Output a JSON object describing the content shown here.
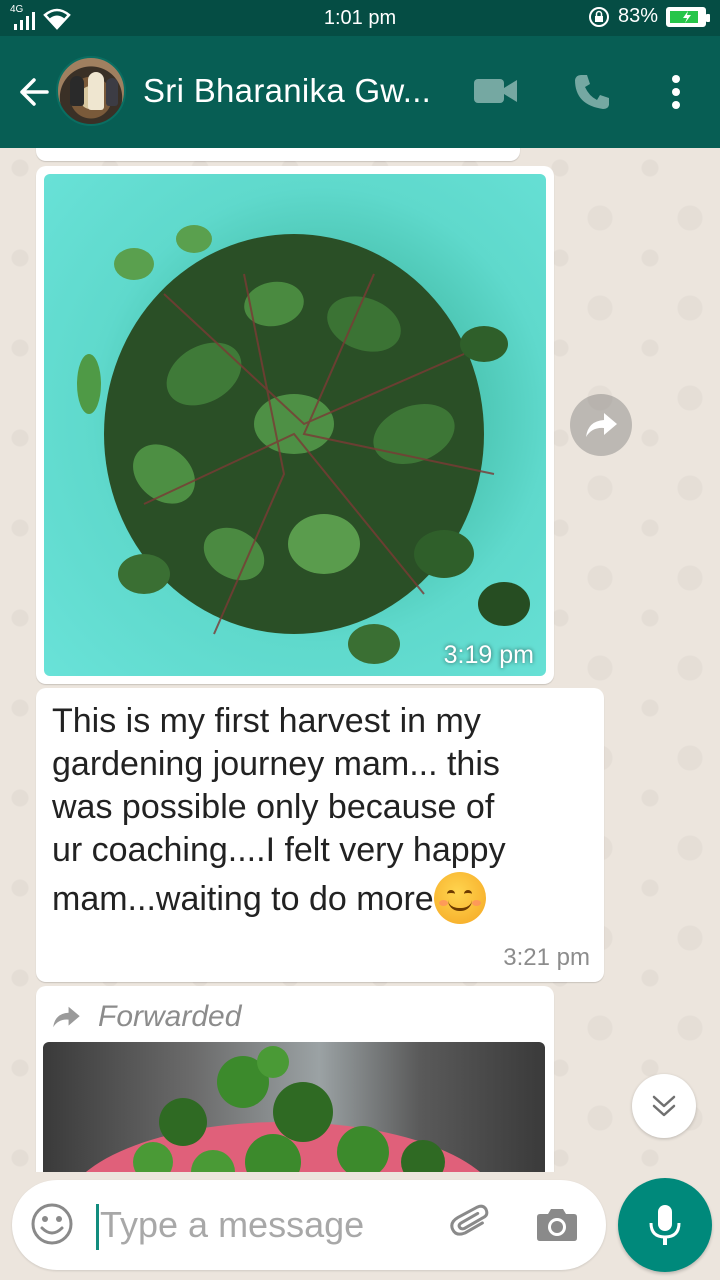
{
  "status_bar": {
    "network": "4G",
    "time": "1:01 pm",
    "battery": "83%"
  },
  "header": {
    "contact_name": "Sri Bharanika Gw..."
  },
  "messages": [
    {
      "type": "image",
      "time": "3:19 pm",
      "description_icon": "image-spinach-leaves"
    },
    {
      "type": "text",
      "text": "This is my first harvest in my\ngardening journey mam... this\nwas possible only because of\nur coaching....I felt very happy\nmam...waiting to do more",
      "time": "3:21 pm"
    },
    {
      "type": "image",
      "forwarded_label": "Forwarded"
    }
  ],
  "composer": {
    "placeholder": "Type a message"
  },
  "colors": {
    "header": "#075e54",
    "status_bar": "#054d44",
    "accent": "#00897b",
    "chat_bg": "#ece5dd"
  }
}
